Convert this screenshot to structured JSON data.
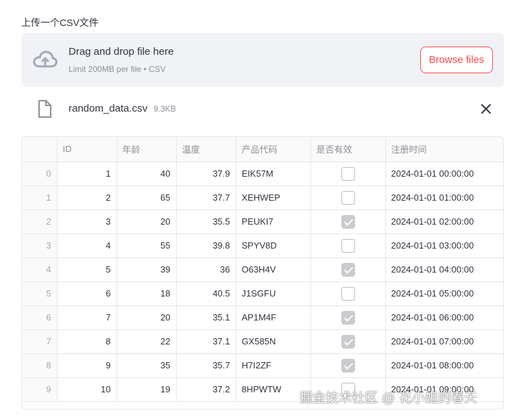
{
  "uploader": {
    "label": "上传一个CSV文件",
    "drop_title": "Drag and drop file here",
    "drop_limit": "Limit 200MB per file • CSV",
    "browse_label": "Browse files",
    "icon": "cloud-upload-icon"
  },
  "file": {
    "name": "random_data.csv",
    "size": "9.3KB",
    "icon": "file-icon"
  },
  "table": {
    "columns": [
      "",
      "ID",
      "年龄",
      "温度",
      "产品代码",
      "是否有效",
      "注册时间"
    ],
    "rows": [
      {
        "idx": "0",
        "id": "1",
        "age": "40",
        "temp": "37.9",
        "code": "EIK57M",
        "valid": false,
        "time": "2024-01-01 00:00:00"
      },
      {
        "idx": "1",
        "id": "2",
        "age": "65",
        "temp": "37.7",
        "code": "XEHWEP",
        "valid": false,
        "time": "2024-01-01 01:00:00"
      },
      {
        "idx": "2",
        "id": "3",
        "age": "20",
        "temp": "35.5",
        "code": "PEUKI7",
        "valid": true,
        "time": "2024-01-01 02:00:00"
      },
      {
        "idx": "3",
        "id": "4",
        "age": "55",
        "temp": "39.8",
        "code": "SPYV8D",
        "valid": false,
        "time": "2024-01-01 03:00:00"
      },
      {
        "idx": "4",
        "id": "5",
        "age": "39",
        "temp": "36",
        "code": "O63H4V",
        "valid": true,
        "time": "2024-01-01 04:00:00"
      },
      {
        "idx": "5",
        "id": "6",
        "age": "18",
        "temp": "40.5",
        "code": "J1SGFU",
        "valid": false,
        "time": "2024-01-01 05:00:00"
      },
      {
        "idx": "6",
        "id": "7",
        "age": "20",
        "temp": "35.1",
        "code": "AP1M4F",
        "valid": true,
        "time": "2024-01-01 06:00:00"
      },
      {
        "idx": "7",
        "id": "8",
        "age": "22",
        "temp": "37.1",
        "code": "GX585N",
        "valid": true,
        "time": "2024-01-01 07:00:00"
      },
      {
        "idx": "8",
        "id": "9",
        "age": "35",
        "temp": "35.7",
        "code": "H7I2ZF",
        "valid": true,
        "time": "2024-01-01 08:00:00"
      },
      {
        "idx": "9",
        "id": "10",
        "age": "19",
        "temp": "37.2",
        "code": "8HPWTW",
        "valid": false,
        "time": "2024-01-01 09:00:00"
      }
    ]
  },
  "watermark": "掘金技术社区 @ 花小姐的春天",
  "colors": {
    "accent": "#ff4b4b",
    "dropzone_bg": "#f0f2f6"
  }
}
